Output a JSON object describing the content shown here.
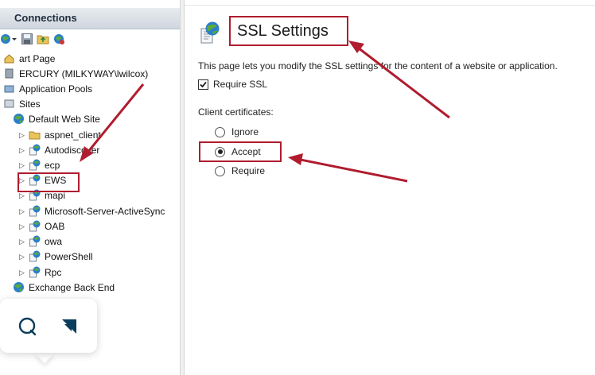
{
  "connections": {
    "title": "Connections",
    "tree": [
      {
        "label": "art Page",
        "indent": 0,
        "icon": "home-icon",
        "expander": false
      },
      {
        "label": "ERCURY (MILKYWAY\\lwilcox)",
        "indent": 0,
        "icon": "server-icon",
        "expander": false
      },
      {
        "label": "Application Pools",
        "indent": 0,
        "icon": "app-pools-icon",
        "expander": false
      },
      {
        "label": "Sites",
        "indent": 0,
        "icon": "sites-icon",
        "expander": false
      },
      {
        "label": "Default Web Site",
        "indent": 1,
        "icon": "globe-icon",
        "expander": false
      },
      {
        "label": "aspnet_client",
        "indent": 2,
        "icon": "folder-icon",
        "expander": true
      },
      {
        "label": "Autodiscover",
        "indent": 2,
        "icon": "web-app-icon",
        "expander": true
      },
      {
        "label": "ecp",
        "indent": 2,
        "icon": "web-app-icon",
        "expander": true
      },
      {
        "label": "EWS",
        "indent": 2,
        "icon": "web-app-icon",
        "expander": true
      },
      {
        "label": "mapi",
        "indent": 2,
        "icon": "web-app-icon",
        "expander": true
      },
      {
        "label": "Microsoft-Server-ActiveSync",
        "indent": 2,
        "icon": "web-app-icon",
        "expander": true
      },
      {
        "label": "OAB",
        "indent": 2,
        "icon": "web-app-icon",
        "expander": true
      },
      {
        "label": "owa",
        "indent": 2,
        "icon": "web-app-icon",
        "expander": true
      },
      {
        "label": "PowerShell",
        "indent": 2,
        "icon": "web-app-icon",
        "expander": true
      },
      {
        "label": "Rpc",
        "indent": 2,
        "icon": "web-app-icon",
        "expander": true
      },
      {
        "label": "Exchange Back End",
        "indent": 1,
        "icon": "globe-icon",
        "expander": false
      }
    ]
  },
  "main": {
    "title": "SSL Settings",
    "description": "This page lets you modify the SSL settings for the content of a website or application.",
    "require_ssl_label": "Require SSL",
    "require_ssl_checked": true,
    "client_certs_label": "Client certificates:",
    "options": [
      {
        "label": "Ignore",
        "selected": false
      },
      {
        "label": "Accept",
        "selected": true
      },
      {
        "label": "Require",
        "selected": false
      }
    ]
  },
  "colors": {
    "annotation_red": "#b01c2e",
    "globe_blue": "#2a7fc9",
    "globe_green": "#5aaa3c"
  }
}
